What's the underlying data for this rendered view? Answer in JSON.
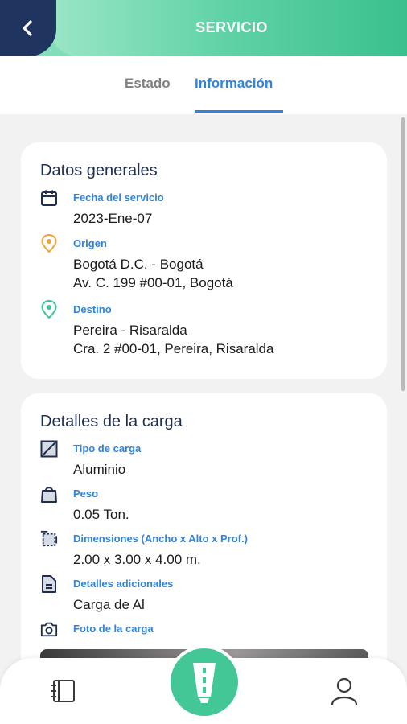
{
  "header": {
    "title": "SERVICIO",
    "back_icon": "chevron-left-icon"
  },
  "tabs": [
    {
      "label": "Estado",
      "active": false
    },
    {
      "label": "Información",
      "active": true
    }
  ],
  "datos_generales": {
    "title": "Datos generales",
    "fecha": {
      "label": "Fecha del servicio",
      "value": "2023-Ene-07",
      "icon": "calendar-icon"
    },
    "origen": {
      "label": "Origen",
      "line1": "Bogotá D.C. - Bogotá",
      "line2": "Av. C. 199 #00-01, Bogotá",
      "icon": "location-pin-orange-icon"
    },
    "destino": {
      "label": "Destino",
      "line1": "Pereira - Risaralda",
      "line2": "Cra. 2 #00-01, Pereira, Risaralda",
      "icon": "location-pin-green-icon"
    }
  },
  "detalles_carga": {
    "title": "Detalles de la carga",
    "tipo": {
      "label": "Tipo de carga",
      "value": "Aluminio",
      "icon": "cargo-box-icon"
    },
    "peso": {
      "label": "Peso",
      "value": "0.05 Ton.",
      "icon": "weight-bag-icon"
    },
    "dimensiones": {
      "label": "Dimensiones (Ancho x Alto x Prof.)",
      "value": "2.00 x 3.00 x 4.00 m.",
      "icon": "dimensions-icon"
    },
    "detalles": {
      "label": "Detalles adicionales",
      "value": "Carga de Al",
      "icon": "document-icon"
    },
    "foto": {
      "label": "Foto de la carga",
      "icon": "camera-icon"
    }
  },
  "colors": {
    "brand_green": "#44c796",
    "navy": "#1f3560",
    "accent_blue": "#2f84de"
  },
  "bottom_nav": {
    "left_icon": "notebook-icon",
    "center_icon": "road-icon",
    "right_icon": "user-icon"
  }
}
